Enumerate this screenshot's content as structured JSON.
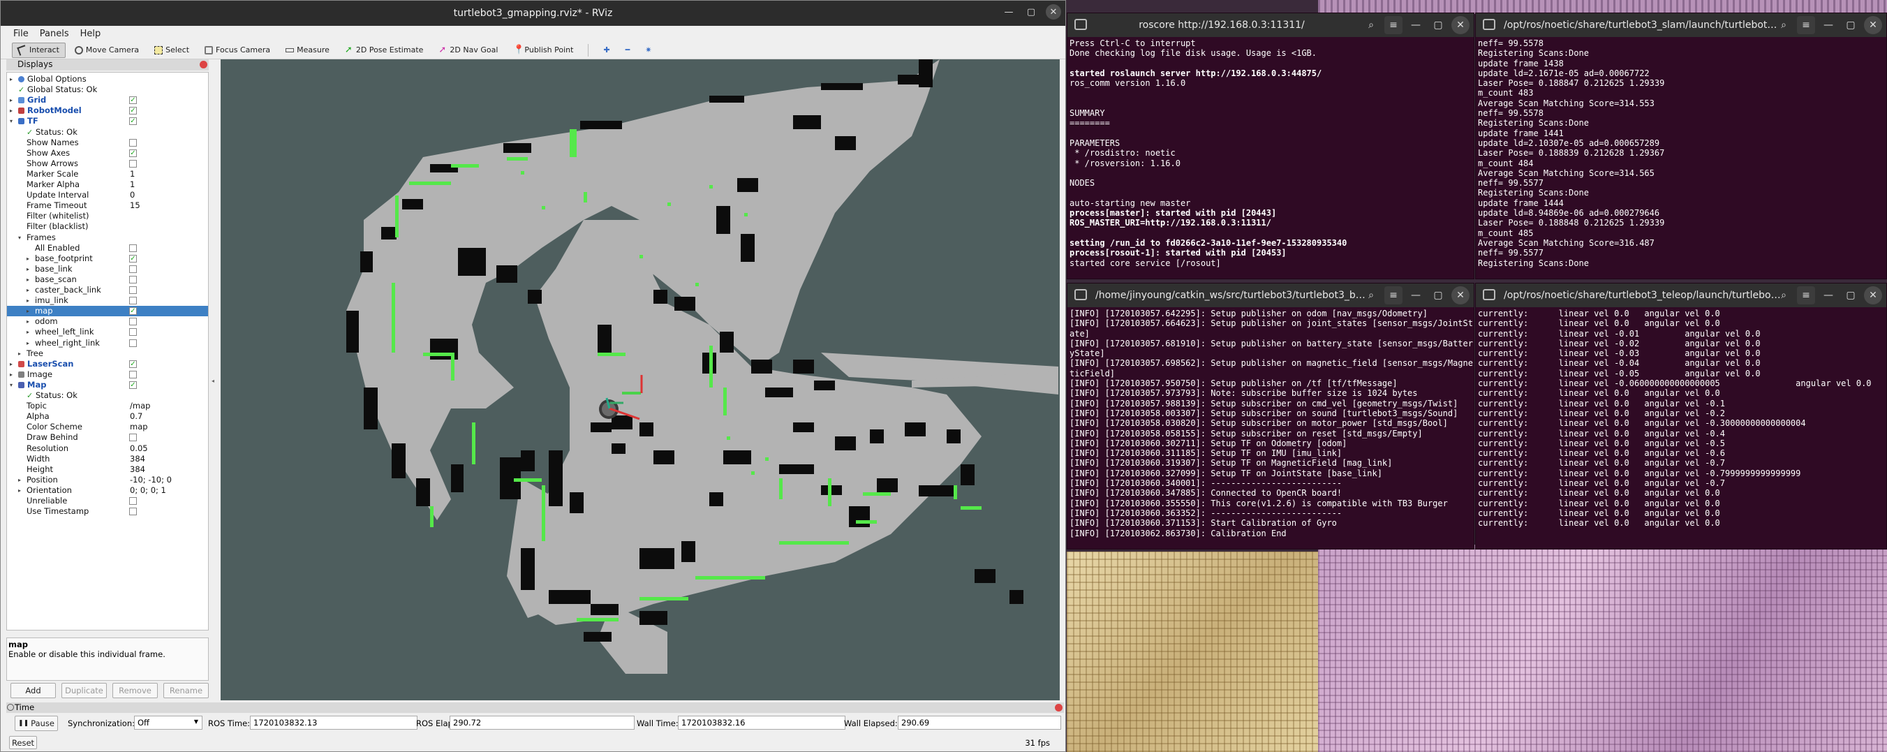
{
  "rviz": {
    "title": "turtlebot3_gmapping.rviz* - RViz",
    "menu": [
      "File",
      "Panels",
      "Help"
    ],
    "tools": [
      "Interact",
      "Move Camera",
      "Select",
      "Focus Camera",
      "Measure",
      "2D Pose Estimate",
      "2D Nav Goal",
      "Publish Point"
    ],
    "displays_title": "Displays",
    "tree": [
      {
        "indent": 0,
        "arrow": "▸",
        "icon": "globe",
        "label": "Global Options"
      },
      {
        "indent": 0,
        "arrow": "",
        "icon": "check",
        "label": "Global Status: Ok"
      },
      {
        "indent": 0,
        "arrow": "▸",
        "icon": "grid",
        "label": "Grid",
        "blue": true,
        "check": true
      },
      {
        "indent": 0,
        "arrow": "▸",
        "icon": "robot",
        "label": "RobotModel",
        "blue": true,
        "check": true
      },
      {
        "indent": 0,
        "arrow": "▾",
        "icon": "tf",
        "label": "TF",
        "blue": true,
        "check": true
      },
      {
        "indent": 1,
        "arrow": "",
        "icon": "check",
        "label": "Status: Ok"
      },
      {
        "indent": 1,
        "label": "Show Names",
        "check": false
      },
      {
        "indent": 1,
        "label": "Show Axes",
        "check": true
      },
      {
        "indent": 1,
        "label": "Show Arrows",
        "check": false
      },
      {
        "indent": 1,
        "label": "Marker Scale",
        "value": "1"
      },
      {
        "indent": 1,
        "label": "Marker Alpha",
        "value": "1"
      },
      {
        "indent": 1,
        "label": "Update Interval",
        "value": "0"
      },
      {
        "indent": 1,
        "label": "Frame Timeout",
        "value": "15"
      },
      {
        "indent": 1,
        "label": "Filter (whitelist)",
        "value": ""
      },
      {
        "indent": 1,
        "label": "Filter (blacklist)",
        "value": ""
      },
      {
        "indent": 1,
        "arrow": "▾",
        "label": "Frames"
      },
      {
        "indent": 2,
        "label": "All Enabled",
        "check": false
      },
      {
        "indent": 2,
        "arrow": "▸",
        "label": "base_footprint",
        "check": true
      },
      {
        "indent": 2,
        "arrow": "▸",
        "label": "base_link",
        "check": false
      },
      {
        "indent": 2,
        "arrow": "▸",
        "label": "base_scan",
        "check": false
      },
      {
        "indent": 2,
        "arrow": "▸",
        "label": "caster_back_link",
        "check": false
      },
      {
        "indent": 2,
        "arrow": "▸",
        "label": "imu_link",
        "check": false
      },
      {
        "indent": 2,
        "arrow": "▸",
        "label": "map",
        "check": true,
        "selected": true
      },
      {
        "indent": 2,
        "arrow": "▸",
        "label": "odom",
        "check": false
      },
      {
        "indent": 2,
        "arrow": "▸",
        "label": "wheel_left_link",
        "check": false
      },
      {
        "indent": 2,
        "arrow": "▸",
        "label": "wheel_right_link",
        "check": false
      },
      {
        "indent": 1,
        "arrow": "▸",
        "label": "Tree"
      },
      {
        "indent": 0,
        "arrow": "▸",
        "icon": "laser",
        "label": "LaserScan",
        "blue": true,
        "check": true
      },
      {
        "indent": 0,
        "arrow": "▸",
        "icon": "image",
        "label": "Image",
        "check": false
      },
      {
        "indent": 0,
        "arrow": "▾",
        "icon": "map",
        "label": "Map",
        "blue": true,
        "check": true
      },
      {
        "indent": 1,
        "arrow": "",
        "icon": "check",
        "label": "Status: Ok"
      },
      {
        "indent": 1,
        "label": "Topic",
        "value": "/map"
      },
      {
        "indent": 1,
        "label": "Alpha",
        "value": "0.7"
      },
      {
        "indent": 1,
        "label": "Color Scheme",
        "value": "map"
      },
      {
        "indent": 1,
        "label": "Draw Behind",
        "check": false
      },
      {
        "indent": 1,
        "label": "Resolution",
        "value": "0.05"
      },
      {
        "indent": 1,
        "label": "Width",
        "value": "384"
      },
      {
        "indent": 1,
        "label": "Height",
        "value": "384"
      },
      {
        "indent": 1,
        "arrow": "▸",
        "label": "Position",
        "value": "-10; -10; 0"
      },
      {
        "indent": 1,
        "arrow": "▸",
        "label": "Orientation",
        "value": "0; 0; 0; 1"
      },
      {
        "indent": 1,
        "label": "Unreliable",
        "check": false
      },
      {
        "indent": 1,
        "label": "Use Timestamp",
        "check": false
      }
    ],
    "desc_title": "map",
    "desc_text": "Enable or disable this individual frame.",
    "buttons": {
      "add": "Add",
      "duplicate": "Duplicate",
      "remove": "Remove",
      "rename": "Rename"
    },
    "time": {
      "title": "Time",
      "pause": "Pause",
      "sync_label": "Synchronization:",
      "sync_value": "Off",
      "ros_time_label": "ROS Time:",
      "ros_time": "1720103832.13",
      "ros_elapsed_label": "ROS Elapsed:",
      "ros_elapsed": "290.72",
      "wall_time_label": "Wall Time:",
      "wall_time": "1720103832.16",
      "wall_elapsed_label": "Wall Elapsed:",
      "wall_elapsed": "290.69",
      "reset": "Reset",
      "fps": "31 fps"
    }
  },
  "roscore": {
    "title": "roscore http://192.168.0.3:11311/",
    "lines": [
      {
        "t": "Press Ctrl-C to interrupt"
      },
      {
        "t": "Done checking log file disk usage. Usage is <1GB."
      },
      {
        "t": ""
      },
      {
        "t": "started roslaunch server http://192.168.0.3:44875/",
        "b": true
      },
      {
        "t": "ros_comm version 1.16.0"
      },
      {
        "t": ""
      },
      {
        "t": ""
      },
      {
        "t": "SUMMARY"
      },
      {
        "t": "========"
      },
      {
        "t": ""
      },
      {
        "t": "PARAMETERS"
      },
      {
        "t": " * /rosdistro: noetic"
      },
      {
        "t": " * /rosversion: 1.16.0"
      },
      {
        "t": ""
      },
      {
        "t": "NODES"
      },
      {
        "t": ""
      },
      {
        "t": "auto-starting new master"
      },
      {
        "t": "process[master]: started with pid [20443]",
        "b": true
      },
      {
        "t": "ROS_MASTER_URI=http://192.168.0.3:11311/",
        "b": true
      },
      {
        "t": ""
      },
      {
        "t": "setting /run_id to fd0266c2-3a10-11ef-9ee7-153280935340",
        "b": true
      },
      {
        "t": "process[rosout-1]: started with pid [20453]",
        "b": true
      },
      {
        "t": "started core service [/rosout]"
      }
    ]
  },
  "slam": {
    "title": "/opt/ros/noetic/share/turtlebot3_slam/launch/turtlebot3_s...",
    "lines": [
      "neff= 99.5578",
      "Registering Scans:Done",
      "update frame 1438",
      "update ld=2.1671e-05 ad=0.00067722",
      "Laser Pose= 0.188847 0.212625 1.29339",
      "m_count 483",
      "Average Scan Matching Score=314.553",
      "neff= 99.5578",
      "Registering Scans:Done",
      "update frame 1441",
      "update ld=2.10307e-05 ad=0.000657289",
      "Laser Pose= 0.188839 0.212628 1.29367",
      "m_count 484",
      "Average Scan Matching Score=314.565",
      "neff= 99.5577",
      "Registering Scans:Done",
      "update frame 1444",
      "update ld=8.94869e-06 ad=0.000279646",
      "Laser Pose= 0.188848 0.212625 1.29339",
      "m_count 485",
      "Average Scan Matching Score=316.487",
      "neff= 99.5577",
      "Registering Scans:Done"
    ]
  },
  "bringup": {
    "title": "/home/jinyoung/catkin_ws/src/turtlebot3/turtlebot3_bring...",
    "lines": [
      "[INFO] [1720103057.642295]: Setup publisher on odom [nav_msgs/Odometry]",
      "[INFO] [1720103057.664623]: Setup publisher on joint_states [sensor_msgs/JointSt",
      "ate]",
      "[INFO] [1720103057.681910]: Setup publisher on battery_state [sensor_msgs/Batter",
      "yState]",
      "[INFO] [1720103057.698562]: Setup publisher on magnetic_field [sensor_msgs/Magne",
      "ticField]",
      "[INFO] [1720103057.950750]: Setup publisher on /tf [tf/tfMessage]",
      "[INFO] [1720103057.973793]: Note: subscribe buffer size is 1024 bytes",
      "[INFO] [1720103057.988139]: Setup subscriber on cmd_vel [geometry_msgs/Twist]",
      "[INFO] [1720103058.003307]: Setup subscriber on sound [turtlebot3_msgs/Sound]",
      "[INFO] [1720103058.030820]: Setup subscriber on motor_power [std_msgs/Bool]",
      "[INFO] [1720103058.058155]: Setup subscriber on reset [std_msgs/Empty]",
      "[INFO] [1720103060.302711]: Setup TF on Odometry [odom]",
      "[INFO] [1720103060.311185]: Setup TF on IMU [imu_link]",
      "[INFO] [1720103060.319307]: Setup TF on MagneticField [mag_link]",
      "[INFO] [1720103060.327099]: Setup TF on JointState [base_link]",
      "[INFO] [1720103060.340001]: --------------------------",
      "[INFO] [1720103060.347885]: Connected to OpenCR board!",
      "[INFO] [1720103060.355550]: This core(v1.2.6) is compatible with TB3 Burger",
      "[INFO] [1720103060.363352]: --------------------------",
      "[INFO] [1720103060.371153]: Start Calibration of Gyro",
      "[INFO] [1720103062.863730]: Calibration End"
    ]
  },
  "teleop": {
    "title": "/opt/ros/noetic/share/turtlebot3_teleop/launch/turtlebot3...",
    "lines": [
      "currently:      linear vel 0.0   angular vel 0.0",
      "currently:      linear vel 0.0   angular vel 0.0",
      "currently:      linear vel -0.01         angular vel 0.0",
      "currently:      linear vel -0.02         angular vel 0.0",
      "currently:      linear vel -0.03         angular vel 0.0",
      "currently:      linear vel -0.04         angular vel 0.0",
      "currently:      linear vel -0.05         angular vel 0.0",
      "currently:      linear vel -0.060000000000000005               angular vel 0.0",
      "currently:      linear vel 0.0   angular vel 0.0",
      "currently:      linear vel 0.0   angular vel -0.1",
      "currently:      linear vel 0.0   angular vel -0.2",
      "currently:      linear vel 0.0   angular vel -0.30000000000000004",
      "currently:      linear vel 0.0   angular vel -0.4",
      "currently:      linear vel 0.0   angular vel -0.5",
      "currently:      linear vel 0.0   angular vel -0.6",
      "currently:      linear vel 0.0   angular vel -0.7",
      "currently:      linear vel 0.0   angular vel -0.7999999999999999",
      "currently:      linear vel 0.0   angular vel -0.7",
      "currently:      linear vel 0.0   angular vel 0.0",
      "currently:      linear vel 0.0   angular vel 0.0",
      "currently:      linear vel 0.0   angular vel 0.0",
      "currently:      linear vel 0.0   angular vel 0.0"
    ]
  },
  "colors": {
    "terminal_bg": "#2f0a24",
    "map_free": "#b3b3b3",
    "map_unknown": "#4e5e5e",
    "map_occupied": "#0c0c0c",
    "laser": "#55e84a",
    "selection": "#3d80c4"
  }
}
